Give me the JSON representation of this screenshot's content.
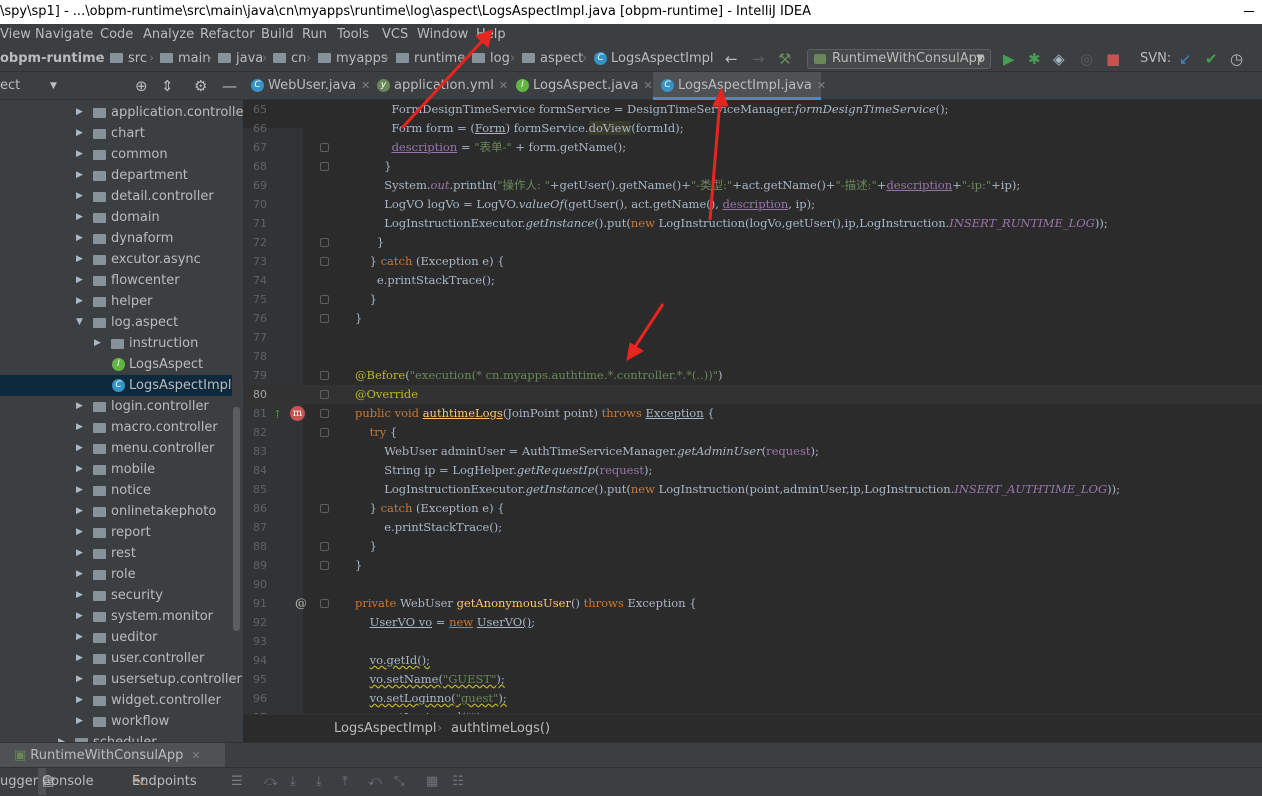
{
  "window": {
    "title": "\\spy\\sp1] - ...\\obpm-runtime\\src\\main\\java\\cn\\myapps\\runtime\\log\\aspect\\LogsAspectImpl.java [obpm-runtime] - IntelliJ IDEA"
  },
  "menu": [
    "View",
    "Navigate",
    "Code",
    "Analyze",
    "Refactor",
    "Build",
    "Run",
    "Tools",
    "VCS",
    "Window",
    "Help"
  ],
  "breadcrumb_nav": [
    "obpm-runtime",
    "src",
    "main",
    "java",
    "cn",
    "myapps",
    "runtime",
    "log",
    "aspect",
    "LogsAspectImpl"
  ],
  "run_config": "RuntimeWithConsulApp",
  "svn_label": "SVN:",
  "project_panel": {
    "title": "ect"
  },
  "tree": [
    {
      "label": "application.controller",
      "type": "folder"
    },
    {
      "label": "chart",
      "type": "folder"
    },
    {
      "label": "common",
      "type": "folder"
    },
    {
      "label": "department",
      "type": "folder"
    },
    {
      "label": "detail.controller",
      "type": "folder"
    },
    {
      "label": "domain",
      "type": "folder"
    },
    {
      "label": "dynaform",
      "type": "folder"
    },
    {
      "label": "excutor.async",
      "type": "folder"
    },
    {
      "label": "flowcenter",
      "type": "folder"
    },
    {
      "label": "helper",
      "type": "folder"
    },
    {
      "label": "log.aspect",
      "type": "folder-open"
    },
    {
      "label": "instruction",
      "type": "subfolder"
    },
    {
      "label": "LogsAspect",
      "type": "interface"
    },
    {
      "label": "LogsAspectImpl",
      "type": "class",
      "selected": true
    },
    {
      "label": "login.controller",
      "type": "folder"
    },
    {
      "label": "macro.controller",
      "type": "folder"
    },
    {
      "label": "menu.controller",
      "type": "folder"
    },
    {
      "label": "mobile",
      "type": "folder"
    },
    {
      "label": "notice",
      "type": "folder"
    },
    {
      "label": "onlinetakephoto",
      "type": "folder"
    },
    {
      "label": "report",
      "type": "folder"
    },
    {
      "label": "rest",
      "type": "folder"
    },
    {
      "label": "role",
      "type": "folder"
    },
    {
      "label": "security",
      "type": "folder"
    },
    {
      "label": "system.monitor",
      "type": "folder"
    },
    {
      "label": "ueditor",
      "type": "folder"
    },
    {
      "label": "user.controller",
      "type": "folder"
    },
    {
      "label": "usersetup.controller",
      "type": "folder"
    },
    {
      "label": "widget.controller",
      "type": "folder"
    },
    {
      "label": "workflow",
      "type": "folder"
    },
    {
      "label": "scheduler",
      "type": "folder"
    }
  ],
  "tabs": [
    {
      "label": "WebUser.java",
      "active": false
    },
    {
      "label": "application.yml",
      "active": false
    },
    {
      "label": "LogsAspect.java",
      "active": false
    },
    {
      "label": "LogsAspectImpl.java",
      "active": true
    }
  ],
  "code_lines": [
    {
      "n": "65"
    },
    {
      "n": "66"
    },
    {
      "n": "67"
    },
    {
      "n": "68"
    },
    {
      "n": "69"
    },
    {
      "n": "70"
    },
    {
      "n": "71"
    },
    {
      "n": "72"
    },
    {
      "n": "73"
    },
    {
      "n": "74"
    },
    {
      "n": "75"
    },
    {
      "n": "76"
    },
    {
      "n": "77"
    },
    {
      "n": "78"
    },
    {
      "n": "79"
    },
    {
      "n": "80"
    },
    {
      "n": "81"
    },
    {
      "n": "82"
    },
    {
      "n": "83"
    },
    {
      "n": "84"
    },
    {
      "n": "85"
    },
    {
      "n": "86"
    },
    {
      "n": "87"
    },
    {
      "n": "88"
    },
    {
      "n": "89"
    },
    {
      "n": "90"
    },
    {
      "n": "91"
    },
    {
      "n": "92"
    },
    {
      "n": "93"
    },
    {
      "n": "94"
    },
    {
      "n": "95"
    },
    {
      "n": "96"
    },
    {
      "n": "97"
    }
  ],
  "code_breadcrumb": [
    "LogsAspectImpl",
    "authtimeLogs()"
  ],
  "run_tab": "RuntimeWithConsulApp",
  "bottom_tabs": [
    "ugger",
    "Console",
    "Endpoints"
  ],
  "colors": {
    "accent": "#4a88c7",
    "annotation_arrows": "#e8251f",
    "bg": "#2b2b2b",
    "panel": "#3c3f41"
  }
}
